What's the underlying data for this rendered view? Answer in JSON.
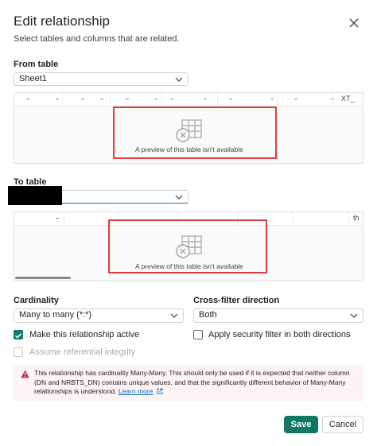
{
  "dialog": {
    "title": "Edit relationship",
    "subtitle": "Select tables and columns that are related.",
    "close_icon": "close-icon"
  },
  "from_table": {
    "label": "From table",
    "selected": "Sheet1",
    "header_text": "XT_",
    "preview_unavailable": "A preview of this table isn't available"
  },
  "to_table": {
    "label": "To table",
    "selected": "",
    "header_text": "th",
    "preview_unavailable": "A preview of this table isn't available"
  },
  "cardinality": {
    "label": "Cardinality",
    "selected": "Many to many (*:*)"
  },
  "cross_filter": {
    "label": "Cross-filter direction",
    "selected": "Both"
  },
  "options": {
    "make_active": {
      "label": "Make this relationship active",
      "checked": true
    },
    "security_filter": {
      "label": "Apply security filter in both directions",
      "checked": false
    },
    "referential_integrity": {
      "label": "Assume referential integrity",
      "checked": false,
      "disabled": true
    }
  },
  "warning": {
    "text": "This relationship has cardinality Many-Many. This should only be used if it is expected that neither column (DN and NRBTS_DN) contains unique values, and that the significantly different behavior of Many-Many relationships is understood.",
    "link": "Learn more"
  },
  "buttons": {
    "save": "Save",
    "cancel": "Cancel"
  },
  "colors": {
    "accent": "#117865",
    "checkbox": "#0f7c6e",
    "annotation_box": "#e23b3b",
    "warning_bg": "#fdf3f4",
    "warning_icon": "#c4314b",
    "link": "#0f6cbd"
  }
}
